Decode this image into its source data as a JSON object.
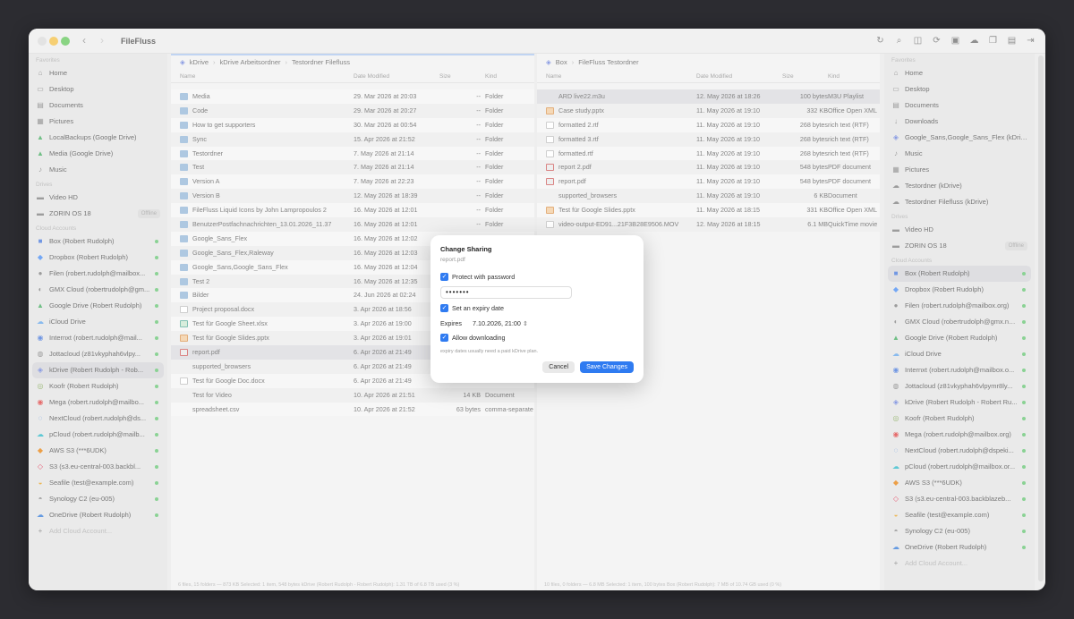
{
  "app": {
    "title": "FileFluss"
  },
  "toolbar": {
    "icons": [
      "refresh-icon",
      "search-icon",
      "split-view-icon",
      "sync-icon",
      "terminal-icon",
      "cloud-icon",
      "copy-icon",
      "clipboard-icon",
      "exit-icon"
    ]
  },
  "left_sidebar": {
    "favorites_title": "Favorites",
    "favorites": [
      {
        "label": "Home",
        "icon": "home-icon"
      },
      {
        "label": "Desktop",
        "icon": "desktop-icon"
      },
      {
        "label": "Documents",
        "icon": "document-icon"
      },
      {
        "label": "Pictures",
        "icon": "pictures-icon"
      },
      {
        "label": "LocalBackups (Google Drive)",
        "icon": "google-drive-icon"
      },
      {
        "label": "Media (Google Drive)",
        "icon": "google-drive-icon"
      },
      {
        "label": "Music",
        "icon": "music-icon"
      }
    ],
    "drives_title": "Drives",
    "drives": [
      {
        "label": "Video HD",
        "icon": "drive-icon"
      },
      {
        "label": "ZORIN OS 18",
        "icon": "drive-icon",
        "badge": "Offline"
      }
    ],
    "cloud_title": "Cloud Accounts",
    "cloud": [
      {
        "label": "Box (Robert Rudolph)",
        "icon": "box-icon"
      },
      {
        "label": "Dropbox (Robert Rudolph)",
        "icon": "dropbox-icon"
      },
      {
        "label": "Filen (robert.rudolph@mailbox...",
        "icon": "filen-icon"
      },
      {
        "label": "GMX Cloud (robertrudolph@gm...",
        "icon": "gmx-icon"
      },
      {
        "label": "Google Drive (Robert Rudolph)",
        "icon": "google-drive-icon"
      },
      {
        "label": "iCloud Drive",
        "icon": "icloud-icon"
      },
      {
        "label": "Internxt (robert.rudolph@mail...",
        "icon": "internxt-icon"
      },
      {
        "label": "Jottacloud (z81vkyphah6vlpy...",
        "icon": "jottacloud-icon"
      },
      {
        "label": "kDrive (Robert Rudolph - Rob...",
        "icon": "kdrive-icon",
        "selected": true
      },
      {
        "label": "Koofr (Robert Rudolph)",
        "icon": "koofr-icon"
      },
      {
        "label": "Mega (robert.rudolph@mailbo...",
        "icon": "mega-icon"
      },
      {
        "label": "NextCloud (robert.rudolph@ds...",
        "icon": "nextcloud-icon"
      },
      {
        "label": "pCloud (robert.rudolph@mailb...",
        "icon": "pcloud-icon"
      },
      {
        "label": "AWS S3 (***6UDK)",
        "icon": "aws-icon"
      },
      {
        "label": "S3 (s3.eu-central-003.backbl...",
        "icon": "s3-icon"
      },
      {
        "label": "Seafile (test@example.com)",
        "icon": "seafile-icon"
      },
      {
        "label": "Synology C2 (eu-005)",
        "icon": "synology-icon"
      },
      {
        "label": "OneDrive (Robert Rudolph)",
        "icon": "onedrive-icon"
      }
    ],
    "add_account": "Add Cloud Account..."
  },
  "right_sidebar": {
    "favorites_title": "Favorites",
    "favorites": [
      {
        "label": "Home",
        "icon": "home-icon"
      },
      {
        "label": "Desktop",
        "icon": "desktop-icon"
      },
      {
        "label": "Documents",
        "icon": "document-icon"
      },
      {
        "label": "Downloads",
        "icon": "downloads-icon"
      },
      {
        "label": "Google_Sans,Google_Sans_Flex (kDriv...",
        "icon": "kdrive-icon"
      },
      {
        "label": "Music",
        "icon": "music-icon"
      },
      {
        "label": "Pictures",
        "icon": "pictures-icon"
      },
      {
        "label": "Testordner (kDrive)",
        "icon": "cloud-icon"
      },
      {
        "label": "Testordner Filefluss (kDrive)",
        "icon": "cloud-icon"
      }
    ],
    "drives_title": "Drives",
    "drives": [
      {
        "label": "Video HD",
        "icon": "drive-icon"
      },
      {
        "label": "ZORIN OS 18",
        "icon": "drive-icon",
        "badge": "Offline"
      }
    ],
    "cloud_title": "Cloud Accounts",
    "cloud": [
      {
        "label": "Box (Robert Rudolph)",
        "icon": "box-icon",
        "selected": true
      },
      {
        "label": "Dropbox (Robert Rudolph)",
        "icon": "dropbox-icon"
      },
      {
        "label": "Filen (robert.rudolph@mailbox.org)",
        "icon": "filen-icon"
      },
      {
        "label": "GMX Cloud (robertrudolph@gmx.ne...",
        "icon": "gmx-icon"
      },
      {
        "label": "Google Drive (Robert Rudolph)",
        "icon": "google-drive-icon"
      },
      {
        "label": "iCloud Drive",
        "icon": "icloud-icon"
      },
      {
        "label": "Internxt (robert.rudolph@mailbox.o...",
        "icon": "internxt-icon"
      },
      {
        "label": "Jottacloud (z81vkyphah6vlpymr8ly...",
        "icon": "jottacloud-icon"
      },
      {
        "label": "kDrive (Robert Rudolph - Robert Ru...",
        "icon": "kdrive-icon"
      },
      {
        "label": "Koofr (Robert Rudolph)",
        "icon": "koofr-icon"
      },
      {
        "label": "Mega (robert.rudolph@mailbox.org)",
        "icon": "mega-icon"
      },
      {
        "label": "NextCloud (robert.rudolph@dspeki...",
        "icon": "nextcloud-icon"
      },
      {
        "label": "pCloud (robert.rudolph@mailbox.or...",
        "icon": "pcloud-icon"
      },
      {
        "label": "AWS S3 (***6UDK)",
        "icon": "aws-icon"
      },
      {
        "label": "S3 (s3.eu-central-003.backblazeb...",
        "icon": "s3-icon"
      },
      {
        "label": "Seafile (test@example.com)",
        "icon": "seafile-icon"
      },
      {
        "label": "Synology C2 (eu-005)",
        "icon": "synology-icon"
      },
      {
        "label": "OneDrive (Robert Rudolph)",
        "icon": "onedrive-icon"
      }
    ],
    "add_account": "Add Cloud Account..."
  },
  "left_pane": {
    "breadcrumb": [
      "kDrive",
      "kDrive Arbeitsordner",
      "Testordner Filefluss"
    ],
    "columns": {
      "name": "Name",
      "date": "Date Modified",
      "size": "Size",
      "kind": "Kind"
    },
    "rows": [
      {
        "icon": "fold",
        "name": "Media",
        "date": "29. Mar 2026 at 20:03",
        "size": "--",
        "kind": "Folder"
      },
      {
        "icon": "fold",
        "name": "Code",
        "date": "29. Mar 2026 at 20:27",
        "size": "--",
        "kind": "Folder"
      },
      {
        "icon": "fold",
        "name": "How to get supporters",
        "date": "30. Mar 2026 at 00:54",
        "size": "--",
        "kind": "Folder"
      },
      {
        "icon": "fold",
        "name": "Sync",
        "date": "15. Apr 2026 at 21:52",
        "size": "--",
        "kind": "Folder"
      },
      {
        "icon": "fold",
        "name": "Testordner",
        "date": "7. May 2026 at 21:14",
        "size": "--",
        "kind": "Folder"
      },
      {
        "icon": "fold",
        "name": "Test",
        "date": "7. May 2026 at 21:14",
        "size": "--",
        "kind": "Folder"
      },
      {
        "icon": "fold",
        "name": "Version A",
        "date": "7. May 2026 at 22:23",
        "size": "--",
        "kind": "Folder"
      },
      {
        "icon": "fold",
        "name": "Version B",
        "date": "12. May 2026 at 18:39",
        "size": "--",
        "kind": "Folder"
      },
      {
        "icon": "fold",
        "name": "FileFluss Liquid Icons by John Lampropoulos 2",
        "date": "16. May 2026 at 12:01",
        "size": "--",
        "kind": "Folder"
      },
      {
        "icon": "fold",
        "name": "BenutzerPostfachnachrichten_13.01.2026_11.37",
        "date": "16. May 2026 at 12:01",
        "size": "--",
        "kind": "Folder"
      },
      {
        "icon": "fold",
        "name": "Google_Sans_Flex",
        "date": "16. May 2026 at 12:02",
        "size": "",
        "kind": ""
      },
      {
        "icon": "fold",
        "name": "Google_Sans_Flex,Raleway",
        "date": "16. May 2026 at 12:03",
        "size": "",
        "kind": ""
      },
      {
        "icon": "fold",
        "name": "Google_Sans,Google_Sans_Flex",
        "date": "16. May 2026 at 12:04",
        "size": "",
        "kind": ""
      },
      {
        "icon": "fold",
        "name": "Test 2",
        "date": "16. May 2026 at 12:35",
        "size": "",
        "kind": ""
      },
      {
        "icon": "fold",
        "name": "Bilder",
        "date": "24. Jun 2026 at 02:24",
        "size": "",
        "kind": ""
      },
      {
        "icon": "doc",
        "name": "Project proposal.docx",
        "date": "3. Apr 2026 at 18:56",
        "size": "",
        "kind": ""
      },
      {
        "icon": "xls",
        "name": "Test für Google Sheet.xlsx",
        "date": "3. Apr 2026 at 19:00",
        "size": "",
        "kind": ""
      },
      {
        "icon": "pres",
        "name": "Test für Google Slides.pptx",
        "date": "3. Apr 2026 at 19:01",
        "size": "",
        "kind": ""
      },
      {
        "icon": "pdf",
        "name": "report.pdf",
        "date": "6. Apr 2026 at 21:49",
        "size": "",
        "kind": "",
        "selected": true
      },
      {
        "icon": "plain",
        "name": "supported_browsers",
        "date": "6. Apr 2026 at 21:49",
        "size": "",
        "kind": ""
      },
      {
        "icon": "doc",
        "name": "Test für Google Doc.docx",
        "date": "6. Apr 2026 at 21:49",
        "size": "",
        "kind": ""
      },
      {
        "icon": "plain",
        "name": "Test for Video",
        "date": "10. Apr 2026 at 21:51",
        "size": "14 KB",
        "kind": "Document"
      },
      {
        "icon": "plain",
        "name": "spreadsheet.csv",
        "date": "10. Apr 2026 at 21:52",
        "size": "63 bytes",
        "kind": "comma-separate"
      }
    ],
    "status": "6 files, 15 folders — 873 KB     Selected: 1 item, 548 bytes     kDrive (Robert Rudolph - Robert Rudolph): 1.31 TB of 6.8 TB used (3 %)"
  },
  "right_pane": {
    "breadcrumb": [
      "Box",
      "FileFluss Testordner"
    ],
    "columns": {
      "name": "Name",
      "date": "Date Modified",
      "size": "Size",
      "kind": "Kind"
    },
    "rows": [
      {
        "icon": "plain",
        "name": "ARD live22.m3u",
        "date": "12. May 2026 at 18:26",
        "size": "100 bytes",
        "kind": "M3U Playlist",
        "selected": true
      },
      {
        "icon": "pres",
        "name": "Case study.pptx",
        "date": "11. May 2026 at 19:10",
        "size": "332 KB",
        "kind": "Office Open XML"
      },
      {
        "icon": "doc",
        "name": "formatted 2.rtf",
        "date": "11. May 2026 at 19:10",
        "size": "268 bytes",
        "kind": "rich text (RTF)"
      },
      {
        "icon": "doc",
        "name": "formatted 3.rtf",
        "date": "11. May 2026 at 19:10",
        "size": "268 bytes",
        "kind": "rich text (RTF)"
      },
      {
        "icon": "doc",
        "name": "formatted.rtf",
        "date": "11. May 2026 at 19:10",
        "size": "268 bytes",
        "kind": "rich text (RTF)"
      },
      {
        "icon": "pdf",
        "name": "report 2.pdf",
        "date": "11. May 2026 at 19:10",
        "size": "548 bytes",
        "kind": "PDF document"
      },
      {
        "icon": "pdf",
        "name": "report.pdf",
        "date": "11. May 2026 at 19:10",
        "size": "548 bytes",
        "kind": "PDF document"
      },
      {
        "icon": "plain",
        "name": "supported_browsers",
        "date": "11. May 2026 at 19:10",
        "size": "6 KB",
        "kind": "Document"
      },
      {
        "icon": "pres",
        "name": "Test für Google Slides.pptx",
        "date": "11. May 2026 at 18:15",
        "size": "331 KB",
        "kind": "Office Open XML"
      },
      {
        "icon": "doc",
        "name": "video-output-ED91...21F3B28E9506.MOV",
        "date": "12. May 2026 at 18:15",
        "size": "6.1 MB",
        "kind": "QuickTime movie"
      }
    ],
    "status": "10 files, 0 folders — 6.8 MB     Selected: 1 item, 100 bytes     Box (Robert Rudolph): 7 MB of 10.74 GB used (0 %)"
  },
  "dialog": {
    "title": "Change Sharing",
    "subtitle": "report.pdf",
    "protect_label": "Protect with password",
    "password_value": "•••••••",
    "expiry_label": "Set an expiry date",
    "expires_label": "Expires",
    "expires_value": "7.10.2026, 21:00",
    "download_label": "Allow downloading",
    "note": "expiry dates usually need a paid kDrive plan.",
    "cancel": "Cancel",
    "save": "Save Changes"
  }
}
